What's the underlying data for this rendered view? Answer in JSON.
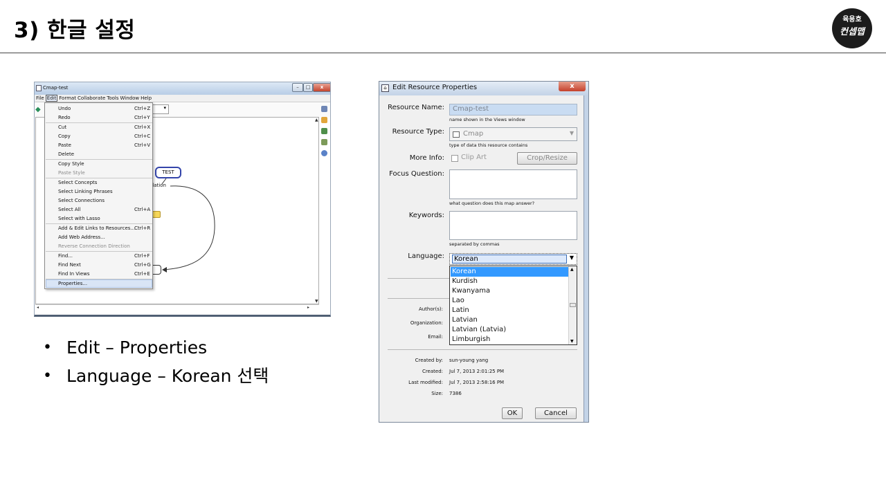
{
  "slide": {
    "title": "3) 한글 설정",
    "logo_line1": "육용호",
    "logo_line2": "컨셉맵"
  },
  "bullets": [
    {
      "bullet": "•",
      "text": "Edit – Properties"
    },
    {
      "bullet": "•",
      "text": "Language – Korean 선택"
    }
  ],
  "cmap_window": {
    "title": "Cmap-test",
    "window_buttons": [
      "–",
      "□",
      "x"
    ],
    "menubar": [
      "File",
      "Edit",
      "Format",
      "Collaborate",
      "Tools",
      "Window",
      "Help"
    ],
    "active_menu": "Edit",
    "edit_menu": [
      {
        "label": "Undo",
        "shortcut": "Ctrl+Z",
        "disabled": false
      },
      {
        "label": "Redo",
        "shortcut": "Ctrl+Y",
        "disabled": false
      },
      {
        "label": "Cut",
        "shortcut": "Ctrl+X",
        "disabled": false
      },
      {
        "label": "Copy",
        "shortcut": "Ctrl+C",
        "disabled": false
      },
      {
        "label": "Paste",
        "shortcut": "Ctrl+V",
        "disabled": false
      },
      {
        "label": "Delete",
        "shortcut": "",
        "disabled": false
      },
      {
        "label": "Copy Style",
        "shortcut": "",
        "disabled": false
      },
      {
        "label": "Paste Style",
        "shortcut": "",
        "disabled": true
      },
      {
        "label": "Select Concepts",
        "shortcut": "",
        "disabled": false
      },
      {
        "label": "Select Linking Phrases",
        "shortcut": "",
        "disabled": false
      },
      {
        "label": "Select Connections",
        "shortcut": "",
        "disabled": false
      },
      {
        "label": "Select All",
        "shortcut": "Ctrl+A",
        "disabled": false
      },
      {
        "label": "Select with Lasso",
        "shortcut": "",
        "disabled": false
      },
      {
        "label": "Add & Edit Links to Resources...",
        "shortcut": "Ctrl+R",
        "disabled": false
      },
      {
        "label": "Add Web Address...",
        "shortcut": "",
        "disabled": false
      },
      {
        "label": "Reverse Connection Direction",
        "shortcut": "",
        "disabled": true
      },
      {
        "label": "Find...",
        "shortcut": "Ctrl+F",
        "disabled": false
      },
      {
        "label": "Find Next",
        "shortcut": "Ctrl+G",
        "disabled": false
      },
      {
        "label": "Find In Views",
        "shortcut": "Ctrl+E",
        "disabled": false
      },
      {
        "label": "Properties...",
        "shortcut": "",
        "disabled": false,
        "highlighted": true
      }
    ],
    "concept_label": "TEST",
    "linking_phrase": "elation"
  },
  "dialog": {
    "title": "Edit Resource Properties",
    "close_label": "x",
    "resource_name_label": "Resource Name:",
    "resource_name_value": "Cmap-test",
    "resource_name_hint": "name shown in the Views window",
    "resource_type_label": "Resource Type:",
    "resource_type_value": "Cmap",
    "resource_type_hint": "type of data this resource contains",
    "more_info_label": "More Info:",
    "clip_art_label": "Clip Art",
    "crop_resize_label": "Crop/Resize",
    "focus_question_label": "Focus Question:",
    "focus_question_hint": "what question does this map answer?",
    "keywords_label": "Keywords:",
    "keywords_hint": "separated by commas",
    "language_label": "Language:",
    "language_value": "Korean",
    "language_options": [
      "Korean",
      "Kurdish",
      "Kwanyama",
      "Lao",
      "Latin",
      "Latvian",
      "Latvian (Latvia)",
      "Limburgish"
    ],
    "authors_label": "Author(s):",
    "organization_label": "Organization:",
    "email_label": "Email:",
    "created_by_label": "Created by:",
    "created_by_value": "sun-young yang",
    "created_label": "Created:",
    "created_value": "Jul 7, 2013 2:01:25 PM",
    "last_modified_label": "Last modified:",
    "last_modified_value": "Jul 7, 2013 2:58:16 PM",
    "size_label": "Size:",
    "size_value": "7386",
    "ok_label": "OK",
    "cancel_label": "Cancel"
  }
}
